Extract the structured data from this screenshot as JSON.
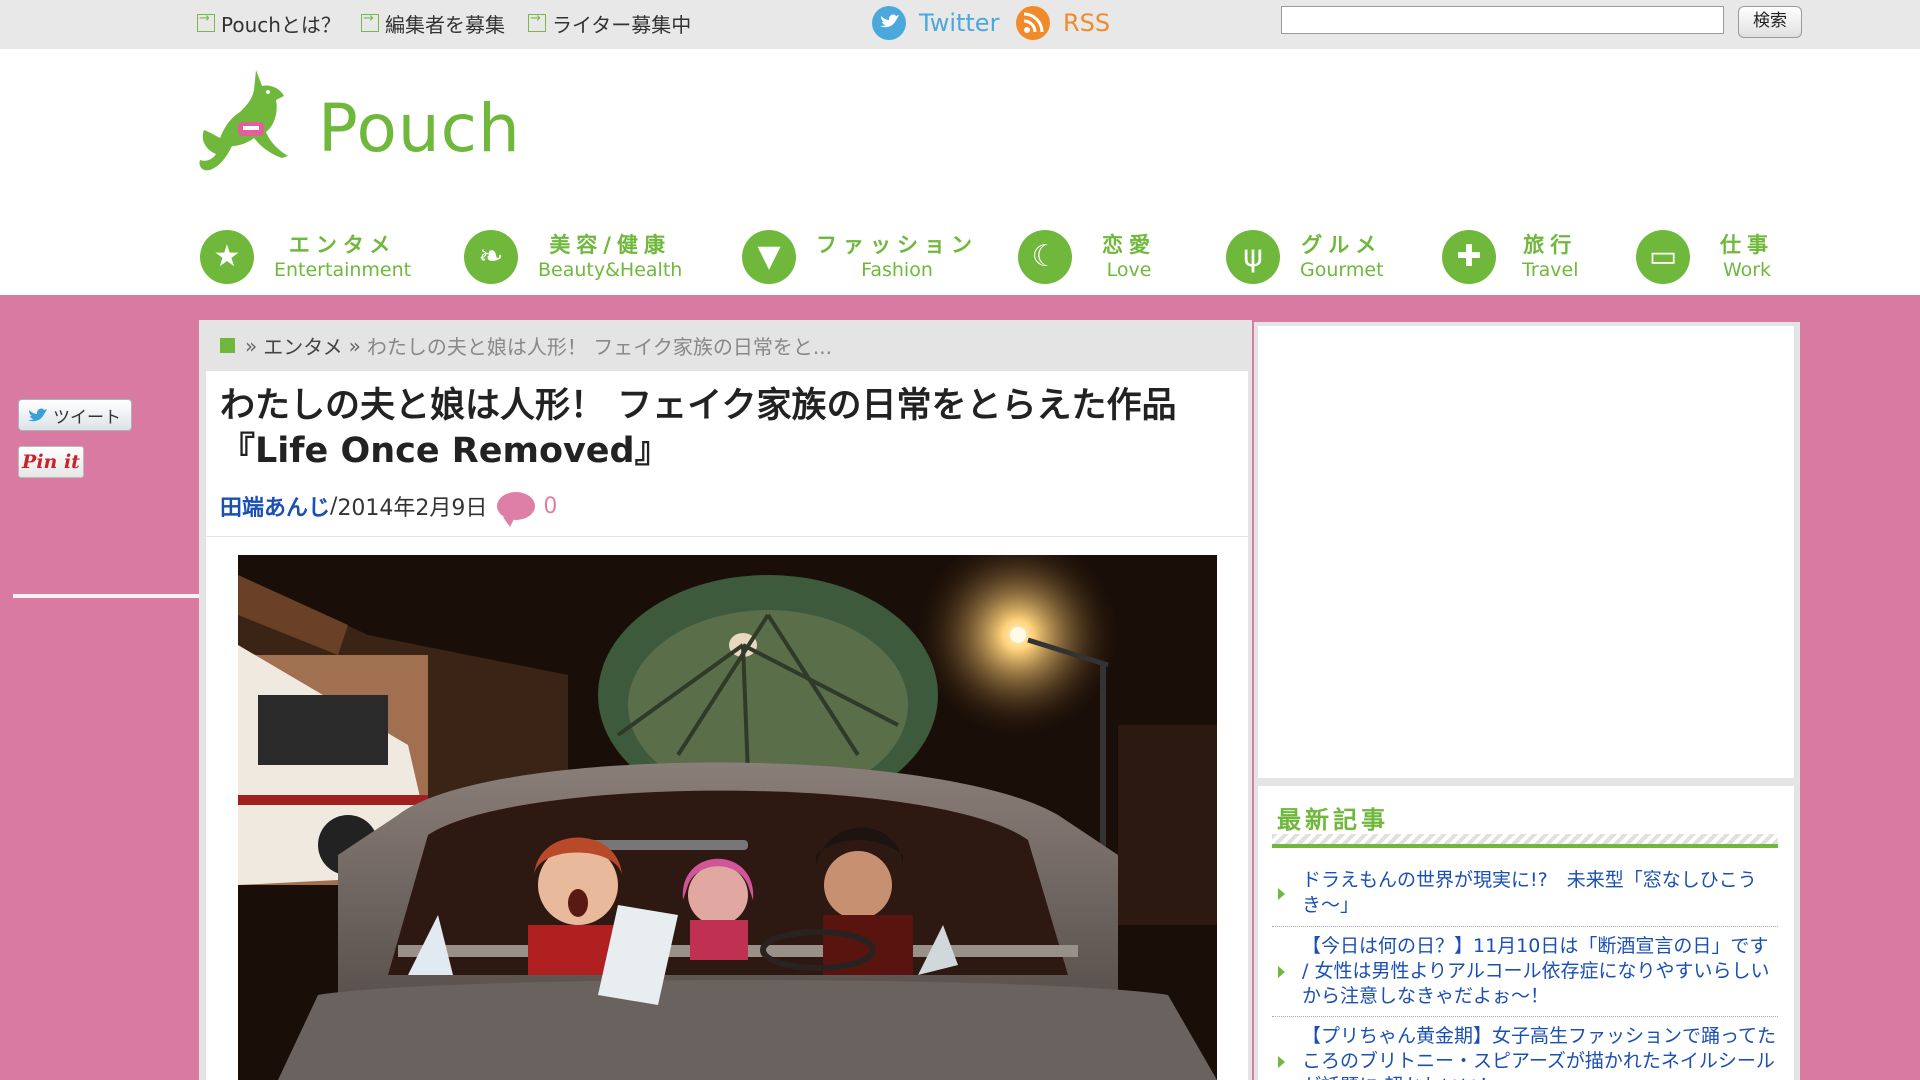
{
  "topbar": {
    "links": [
      {
        "label": "Pouchとは？"
      },
      {
        "label": "編集者を募集"
      },
      {
        "label": "ライター募集中"
      }
    ],
    "twitter_label": "Twitter",
    "rss_label": "RSS",
    "search_value": "",
    "search_button": "検索"
  },
  "header": {
    "logo_text": "Pouch"
  },
  "nav": [
    {
      "jp": "エンタメ",
      "en": "Entertainment",
      "icon": "star-icon"
    },
    {
      "jp": "美容/健康",
      "en": "Beauty&Health",
      "icon": "leaf-icon"
    },
    {
      "jp": "ファッション",
      "en": "Fashion",
      "icon": "shirt-icon"
    },
    {
      "jp": "恋愛",
      "en": "Love",
      "icon": "crescent-icon"
    },
    {
      "jp": "グルメ",
      "en": "Gourmet",
      "icon": "fork-knife-icon"
    },
    {
      "jp": "旅行",
      "en": "Travel",
      "icon": "globe-icon"
    },
    {
      "jp": "仕事",
      "en": "Work",
      "icon": "card-icon"
    }
  ],
  "share": {
    "tweet_label": "ツイート",
    "pin_label": "Pin it"
  },
  "breadcrumb": {
    "sep": "»",
    "category": "エンタメ",
    "current": "わたしの夫と娘は人形！ フェイク家族の日常をと..."
  },
  "article": {
    "title_line1": "わたしの夫と娘は人形！ フェイク家族の日常をとらえた作品",
    "title_line2": "『Life Once Removed』",
    "author": "田端あんじ",
    "meta_sep": " / ",
    "date": "2014年2月9日",
    "comment_count": "0"
  },
  "sidebar": {
    "latest_title": "最新記事",
    "news": [
      "ドラえもんの世界が現実に!?　未来型「窓なしひこうき〜」",
      "【今日は何の日？】11月10日は「断酒宣言の日」です / 女性は男性よりアルコール依存症になりやすいらしいから注意しなきゃだよぉ〜！",
      "【プリちゃん黄金期】女子高生ファッションで踊ってたころのブリトニー・スピアーズが描かれたネイルシールが話題に 超かわいい！"
    ]
  },
  "colors": {
    "accent_green": "#6fb83c",
    "pink_bg": "#d97aa3",
    "link_blue": "#1a4fb4"
  }
}
